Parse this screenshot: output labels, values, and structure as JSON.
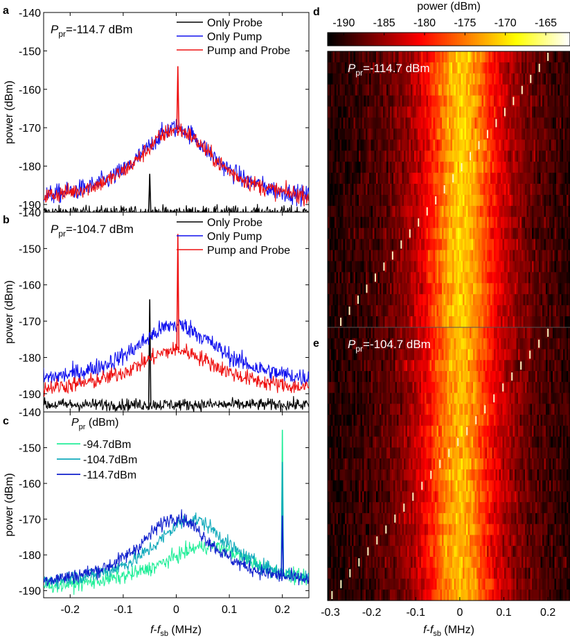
{
  "panel_letters": {
    "a": "a",
    "b": "b",
    "c": "c",
    "d": "d",
    "e": "e"
  },
  "left_common": {
    "ylabel": "power (dBm)",
    "xlabel_main": "f",
    "xlabel_dash": "-",
    "xlabel_sub_base": "f",
    "xlabel_sub": "sb",
    "xlabel_units": " (MHz)"
  },
  "chart_data": [
    {
      "panel": "a",
      "type": "line",
      "xlim": [
        -0.25,
        0.25
      ],
      "ylim": [
        -192,
        -140
      ],
      "yticks": [
        -190,
        -180,
        -170,
        -160,
        -150,
        -140
      ],
      "ytick_labels": [
        "-190",
        "-180",
        "-170",
        "-160",
        "-150",
        "-140"
      ],
      "xticks": [
        -0.2,
        -0.1,
        0,
        0.1,
        0.2
      ],
      "annotation": {
        "prefix": "P",
        "sub": "pr",
        "suffix": "=-114.7 dBm"
      },
      "legend_position": "top-right",
      "series": [
        {
          "name": "Only Probe",
          "color": "#000000",
          "baseline": -192,
          "peak_height": -192,
          "width": 0.12,
          "center": 0.0,
          "noise": 1.2,
          "spikes": [
            {
              "x": -0.05,
              "y": -182
            }
          ]
        },
        {
          "name": "Only Pump",
          "color": "#1010ee",
          "baseline": -190,
          "peak_height": -170,
          "width": 0.09,
          "center": 0.0,
          "noise": 1.8,
          "spikes": []
        },
        {
          "name": "Pump and Probe",
          "color": "#ee1010",
          "baseline": -190,
          "peak_height": -170.5,
          "width": 0.09,
          "center": 0.0,
          "noise": 1.6,
          "spikes": [
            {
              "x": 0.003,
              "y": -154
            }
          ]
        }
      ]
    },
    {
      "panel": "b",
      "type": "line",
      "xlim": [
        -0.25,
        0.25
      ],
      "ylim": [
        -195,
        -140
      ],
      "yticks": [
        -190,
        -180,
        -170,
        -160,
        -150,
        -140
      ],
      "ytick_labels": [
        "-190",
        "-180",
        "-170",
        "-160",
        "-150",
        "-140"
      ],
      "xticks": [
        -0.2,
        -0.1,
        0,
        0.1,
        0.2
      ],
      "annotation": {
        "prefix": "P",
        "sub": "pr",
        "suffix": "=-104.7 dBm"
      },
      "legend_position": "top-right",
      "series": [
        {
          "name": "Only Probe",
          "color": "#000000",
          "baseline": -193,
          "peak_height": -193,
          "width": 0.12,
          "center": 0.0,
          "noise": 1.2,
          "spikes": [
            {
              "x": -0.05,
              "y": -164
            }
          ]
        },
        {
          "name": "Only Pump",
          "color": "#1010ee",
          "baseline": -188,
          "peak_height": -171,
          "width": 0.1,
          "center": 0.0,
          "noise": 1.8,
          "spikes": []
        },
        {
          "name": "Pump and Probe",
          "color": "#ee1010",
          "baseline": -190,
          "peak_height": -178,
          "width": 0.1,
          "center": 0.0,
          "noise": 1.6,
          "spikes": [
            {
              "x": 0.003,
              "y": -146
            }
          ]
        }
      ]
    },
    {
      "panel": "c",
      "type": "line",
      "xlim": [
        -0.25,
        0.25
      ],
      "ylim": [
        -192,
        -140
      ],
      "yticks": [
        -190,
        -180,
        -170,
        -160,
        -150,
        -140
      ],
      "ytick_labels": [
        "-190",
        "-180",
        "-170",
        "-160",
        "-150",
        "-140"
      ],
      "xticks": [
        -0.2,
        -0.1,
        0,
        0.1,
        0.2
      ],
      "xtick_labels": [
        "-0.2",
        "-0.1",
        "0",
        "0.1",
        "0.2"
      ],
      "legend_title": {
        "prefix": "P",
        "sub": "pr",
        "suffix": " (dBm)"
      },
      "legend_position": "top-left",
      "series": [
        {
          "name": "-94.7dBm",
          "color": "#22ee99",
          "baseline": -190,
          "peak_height": -177.5,
          "width": 0.11,
          "center": 0.06,
          "noise": 1.5,
          "spikes": [
            {
              "x": 0.2,
              "y": -145
            }
          ]
        },
        {
          "name": "-104.7dBm",
          "color": "#11aabb",
          "baseline": -189,
          "peak_height": -170,
          "width": 0.09,
          "center": 0.03,
          "noise": 1.5,
          "spikes": [
            {
              "x": 0.2,
              "y": -154
            }
          ]
        },
        {
          "name": "-114.7dBm",
          "color": "#1020cc",
          "baseline": -189,
          "peak_height": -169.5,
          "width": 0.085,
          "center": 0.0,
          "noise": 1.5,
          "spikes": [
            {
              "x": 0.2,
              "y": -169
            }
          ]
        }
      ]
    },
    {
      "panel": "d",
      "type": "heatmap",
      "xlim": [
        -0.3,
        0.25
      ],
      "xticks": [
        -0.3,
        -0.2,
        -0.1,
        0,
        0.1,
        0.2
      ],
      "xtick_labels": [
        "-0.3",
        "-0.2",
        "-0.1",
        "0",
        "0.1",
        "0.2"
      ],
      "annotation": {
        "prefix": "P",
        "sub": "pr",
        "suffix": "=-114.7 dBm"
      },
      "rows": 25,
      "center": 0.005,
      "width": 0.085,
      "peak": -171,
      "floor": -192,
      "probe_start": -0.27,
      "probe_end": 0.2
    },
    {
      "panel": "e",
      "type": "heatmap",
      "xlim": [
        -0.3,
        0.25
      ],
      "annotation": {
        "prefix": "P",
        "sub": "pr",
        "suffix": "=-104.7 dBm"
      },
      "rows": 25,
      "center": 0.0,
      "width": 0.085,
      "peak": -172,
      "floor": -192,
      "probe_start": -0.29,
      "probe_end": 0.2
    },
    {
      "panel": "colorbar",
      "type": "heatmap",
      "title": "power (dBm)",
      "range": [
        -192,
        -162
      ],
      "ticks": [
        -190,
        -185,
        -180,
        -175,
        -170,
        -165
      ],
      "tick_labels": [
        "-190",
        "-185",
        "-180",
        "-175",
        "-170",
        "-165"
      ],
      "colormap": "hot"
    }
  ]
}
